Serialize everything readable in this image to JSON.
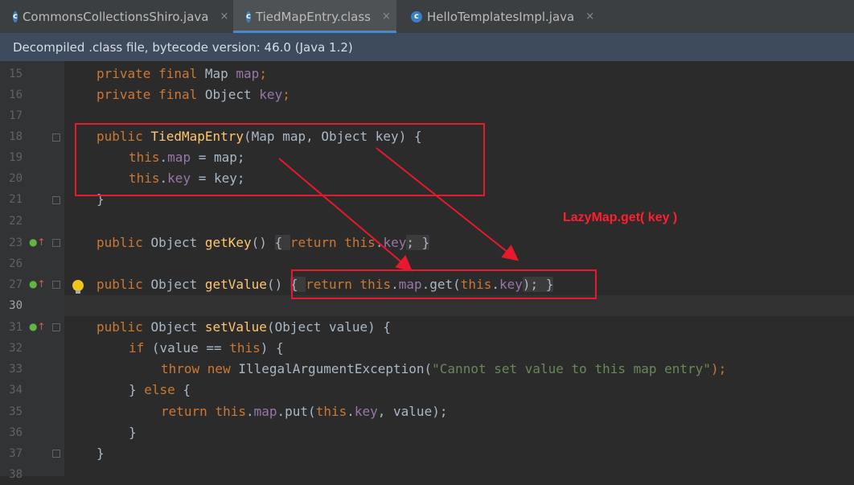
{
  "tabs": [
    {
      "label": "CommonsCollectionsShiro.java",
      "icon": "class-icon",
      "active": false
    },
    {
      "label": "TiedMapEntry.class",
      "icon": "class-icon",
      "active": true
    },
    {
      "label": "HelloTemplatesImpl.java",
      "icon": "class-icon",
      "active": false
    }
  ],
  "tab_close_glyph": "×",
  "banner": "Decompiled .class file, bytecode version: 46.0 (Java 1.2)",
  "annotation": "LazyMap.get( key )",
  "line_numbers": [
    "15",
    "16",
    "17",
    "18",
    "19",
    "20",
    "21",
    "22",
    "23",
    "26",
    "27",
    "30",
    "31",
    "32",
    "33",
    "34",
    "35",
    "36",
    "37",
    "38"
  ],
  "code": {
    "l15": [
      "private",
      " final",
      " Map ",
      "map",
      ";"
    ],
    "l16": [
      "private",
      " final",
      " Object ",
      "key",
      ";"
    ],
    "l18": [
      "public ",
      "TiedMapEntry",
      "(Map map, Object key) {"
    ],
    "l19": [
      "this",
      ".",
      "map",
      " = map;"
    ],
    "l20": [
      "this",
      ".",
      "key",
      " = key;"
    ],
    "l21": "}",
    "l23": [
      "public ",
      "Object ",
      "getKey",
      "() ",
      "{ ",
      "return ",
      "this",
      ".",
      "key",
      "; }"
    ],
    "l27": [
      "public ",
      "Object ",
      "getValue",
      "() ",
      "{ ",
      "return ",
      "this",
      ".",
      "map",
      ".get(",
      "this",
      ".",
      "key",
      "); }"
    ],
    "l31": [
      "public ",
      "Object ",
      "setValue",
      "(Object value) {"
    ],
    "l32": [
      "if",
      " (value == ",
      "this",
      ") {"
    ],
    "l33": [
      "throw ",
      "new ",
      "IllegalArgumentException(",
      "\"Cannot set value to this map entry\"",
      ");"
    ],
    "l34": [
      "} ",
      "else",
      " {"
    ],
    "l35": [
      "return ",
      "this",
      ".",
      "map",
      ".put(",
      "this",
      ".",
      "key",
      ", value);"
    ],
    "l36": "}",
    "l37": "}"
  }
}
